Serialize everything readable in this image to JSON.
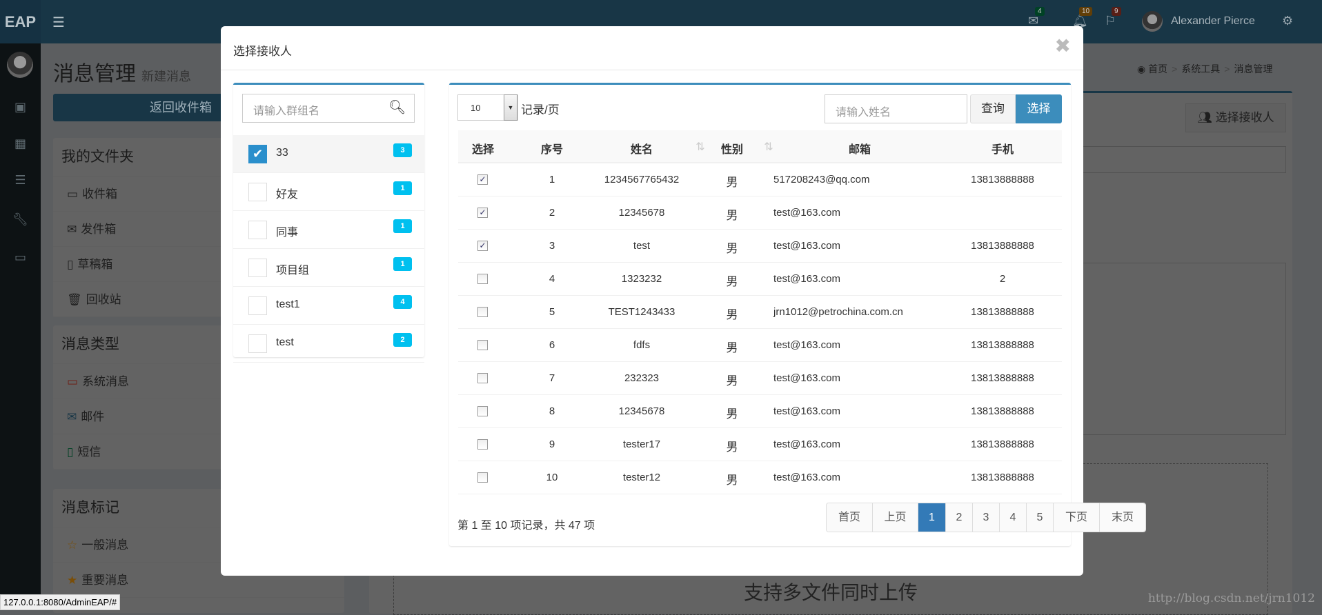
{
  "app": {
    "logo": "EAP",
    "user_name": "Alexander Pierce",
    "status_url": "127.0.0.1:8080/AdminEAP/#",
    "watermark": "http://blog.csdn.net/jrn1012",
    "badges": {
      "messages": "4",
      "notifications": "10",
      "tasks": "9"
    },
    "icons": {
      "menu": "hamburger-icon",
      "messages": "envelope-icon",
      "notifications": "bell-icon",
      "tasks": "flag-icon",
      "settings": "gears-icon"
    }
  },
  "page": {
    "title": "消息管理",
    "subtitle": "新建消息",
    "back_button": "返回收件箱",
    "breadcrumb": [
      "首页",
      "系统工具",
      "消息管理"
    ],
    "folders": {
      "title": "我的文件夹",
      "items": [
        "收件箱",
        "发件箱",
        "草稿箱",
        "回收站"
      ]
    },
    "types": {
      "title": "消息类型",
      "items": [
        "系统消息",
        "邮件",
        "短信"
      ]
    },
    "marks": {
      "title": "消息标记",
      "items": [
        "一般消息",
        "重要消息"
      ]
    },
    "select_recipient_button": "选择接收人",
    "upload_hint": "支持多文件同时上传"
  },
  "modal": {
    "title": "选择接收人",
    "group_search_placeholder": "请输入群组名",
    "groups": [
      {
        "name": "33",
        "count": "3",
        "checked": true
      },
      {
        "name": "好友",
        "count": "1",
        "checked": false
      },
      {
        "name": "同事",
        "count": "1",
        "checked": false
      },
      {
        "name": "项目组",
        "count": "1",
        "checked": false
      },
      {
        "name": "test1",
        "count": "4",
        "checked": false
      },
      {
        "name": "test",
        "count": "2",
        "checked": false
      }
    ],
    "page_size": "10",
    "page_size_label": "记录/页",
    "name_placeholder": "请输入姓名",
    "query_button": "查询",
    "select_button": "选择",
    "columns": [
      "选择",
      "序号",
      "姓名",
      "性别",
      "邮箱",
      "手机"
    ],
    "rows": [
      {
        "checked": true,
        "no": "1",
        "name": "1234567765432",
        "gender": "男",
        "email": "517208243@qq.com",
        "phone": "13813888888"
      },
      {
        "checked": true,
        "no": "2",
        "name": "12345678",
        "gender": "男",
        "email": "test@163.com",
        "phone": ""
      },
      {
        "checked": true,
        "no": "3",
        "name": "test",
        "gender": "男",
        "email": "test@163.com",
        "phone": "13813888888"
      },
      {
        "checked": false,
        "no": "4",
        "name": "1323232",
        "gender": "男",
        "email": "test@163.com",
        "phone": "2"
      },
      {
        "checked": false,
        "no": "5",
        "name": "TEST1243433",
        "gender": "男",
        "email": "jrn1012@petrochina.com.cn",
        "phone": "13813888888"
      },
      {
        "checked": false,
        "no": "6",
        "name": "fdfs",
        "gender": "男",
        "email": "test@163.com",
        "phone": "13813888888"
      },
      {
        "checked": false,
        "no": "7",
        "name": "232323",
        "gender": "男",
        "email": "test@163.com",
        "phone": "13813888888"
      },
      {
        "checked": false,
        "no": "8",
        "name": "12345678",
        "gender": "男",
        "email": "test@163.com",
        "phone": "13813888888"
      },
      {
        "checked": false,
        "no": "9",
        "name": "tester17",
        "gender": "男",
        "email": "test@163.com",
        "phone": "13813888888"
      },
      {
        "checked": false,
        "no": "10",
        "name": "tester12",
        "gender": "男",
        "email": "test@163.com",
        "phone": "13813888888"
      }
    ],
    "summary": "第 1 至 10 项记录，共 47 项",
    "pagination": [
      "首页",
      "上页",
      "1",
      "2",
      "3",
      "4",
      "5",
      "下页",
      "末页"
    ],
    "current_page": "1"
  },
  "colors": {
    "primary": "#3c8dbc",
    "badge": "#00c0ef",
    "active_page": "#337ab7"
  }
}
